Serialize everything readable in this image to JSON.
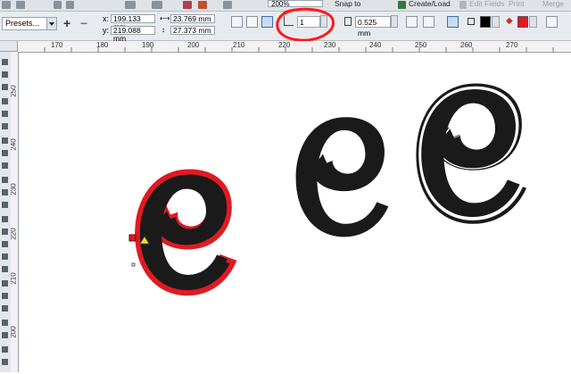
{
  "top_toolbar": {
    "zoom": "200%",
    "snap_to": "Snap to",
    "create_load": "Create/Load",
    "edit_fields": "Edit Fields",
    "print": "Print",
    "merge": "Merge"
  },
  "property_bar": {
    "presets": "Presets...",
    "x_label": "x:",
    "x_value": "199.133 mm",
    "y_label": "y:",
    "y_value": "219.088 mm",
    "width_value": "23.769 mm",
    "height_value": "27.373 mm",
    "steps_value": "1",
    "offset_value": "0.525 mm",
    "outline_color": "#000000",
    "fill_color": "#e01a22"
  },
  "ruler_h_labels": [
    "170",
    "180",
    "190",
    "200",
    "210",
    "220",
    "230",
    "240",
    "250",
    "260",
    "270"
  ],
  "ruler_v_labels": [
    "250",
    "240",
    "230",
    "220",
    "210",
    "200"
  ],
  "colors": {
    "annotation_red": "#ff1a1a",
    "glyph_black": "#1a1a1a",
    "contour_red": "#e01a22"
  }
}
